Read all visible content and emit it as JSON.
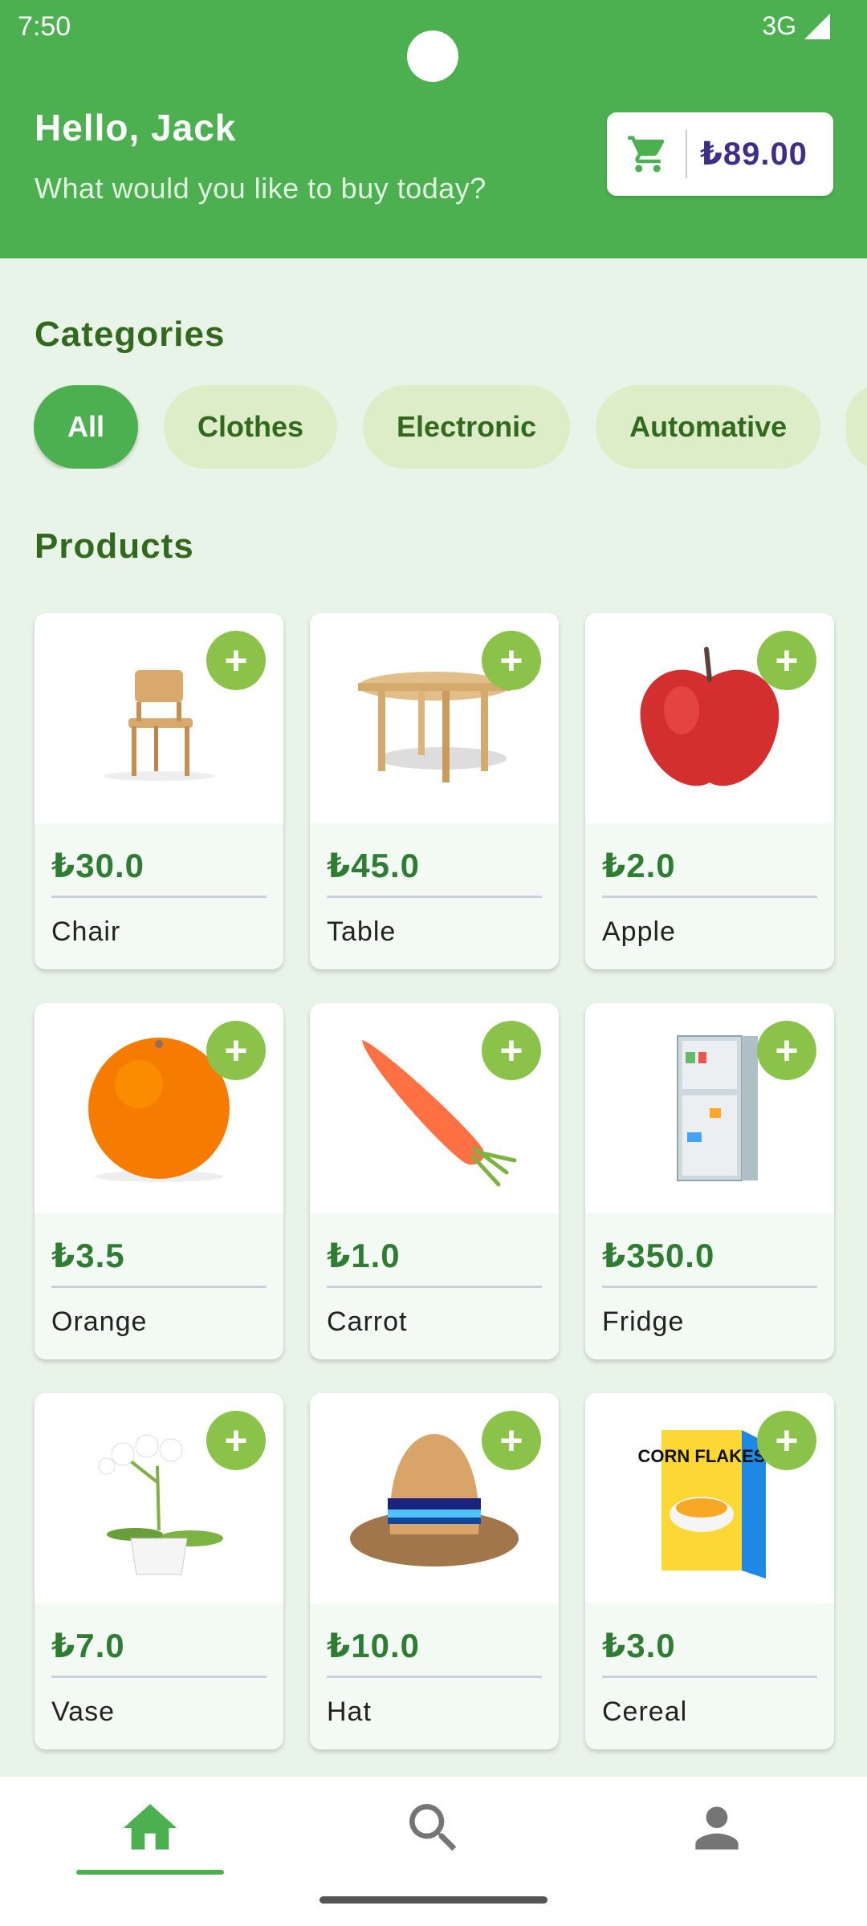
{
  "status_bar": {
    "time": "7:50",
    "network": "3G"
  },
  "header": {
    "greeting": "Hello, Jack",
    "subtitle": "What would you like to buy today?",
    "cart_total": "₺89.00",
    "cart_icon": "cart-icon"
  },
  "categories": {
    "title": "Categories",
    "items": [
      "All",
      "Clothes",
      "Electronic",
      "Automative",
      ""
    ],
    "selected": "All"
  },
  "products": {
    "title": "Products",
    "items": [
      {
        "price": "₺30.0",
        "name": "Chair",
        "image": "chair"
      },
      {
        "price": "₺45.0",
        "name": "Table",
        "image": "table"
      },
      {
        "price": "₺2.0",
        "name": "Apple",
        "image": "apple"
      },
      {
        "price": "₺3.5",
        "name": "Orange",
        "image": "orange"
      },
      {
        "price": "₺1.0",
        "name": "Carrot",
        "image": "carrot"
      },
      {
        "price": "₺350.0",
        "name": "Fridge",
        "image": "fridge"
      },
      {
        "price": "₺7.0",
        "name": "Vase",
        "image": "vase"
      },
      {
        "price": "₺10.0",
        "name": "Hat",
        "image": "hat"
      },
      {
        "price": "₺3.0",
        "name": "Cereal",
        "image": "cereal"
      }
    ],
    "add_label": "+"
  },
  "cereal_box_text": "CORN FLAKES",
  "bottom_nav": {
    "items": [
      {
        "icon": "home-icon",
        "selected": true
      },
      {
        "icon": "search-icon",
        "selected": false
      },
      {
        "icon": "profile-icon",
        "selected": false
      }
    ]
  },
  "colors": {
    "primary": "#4caf50",
    "accent": "#8bc34a",
    "chip_bg": "#dcedc8",
    "price": "#2e7d32",
    "cart_total": "#3f2e86"
  }
}
